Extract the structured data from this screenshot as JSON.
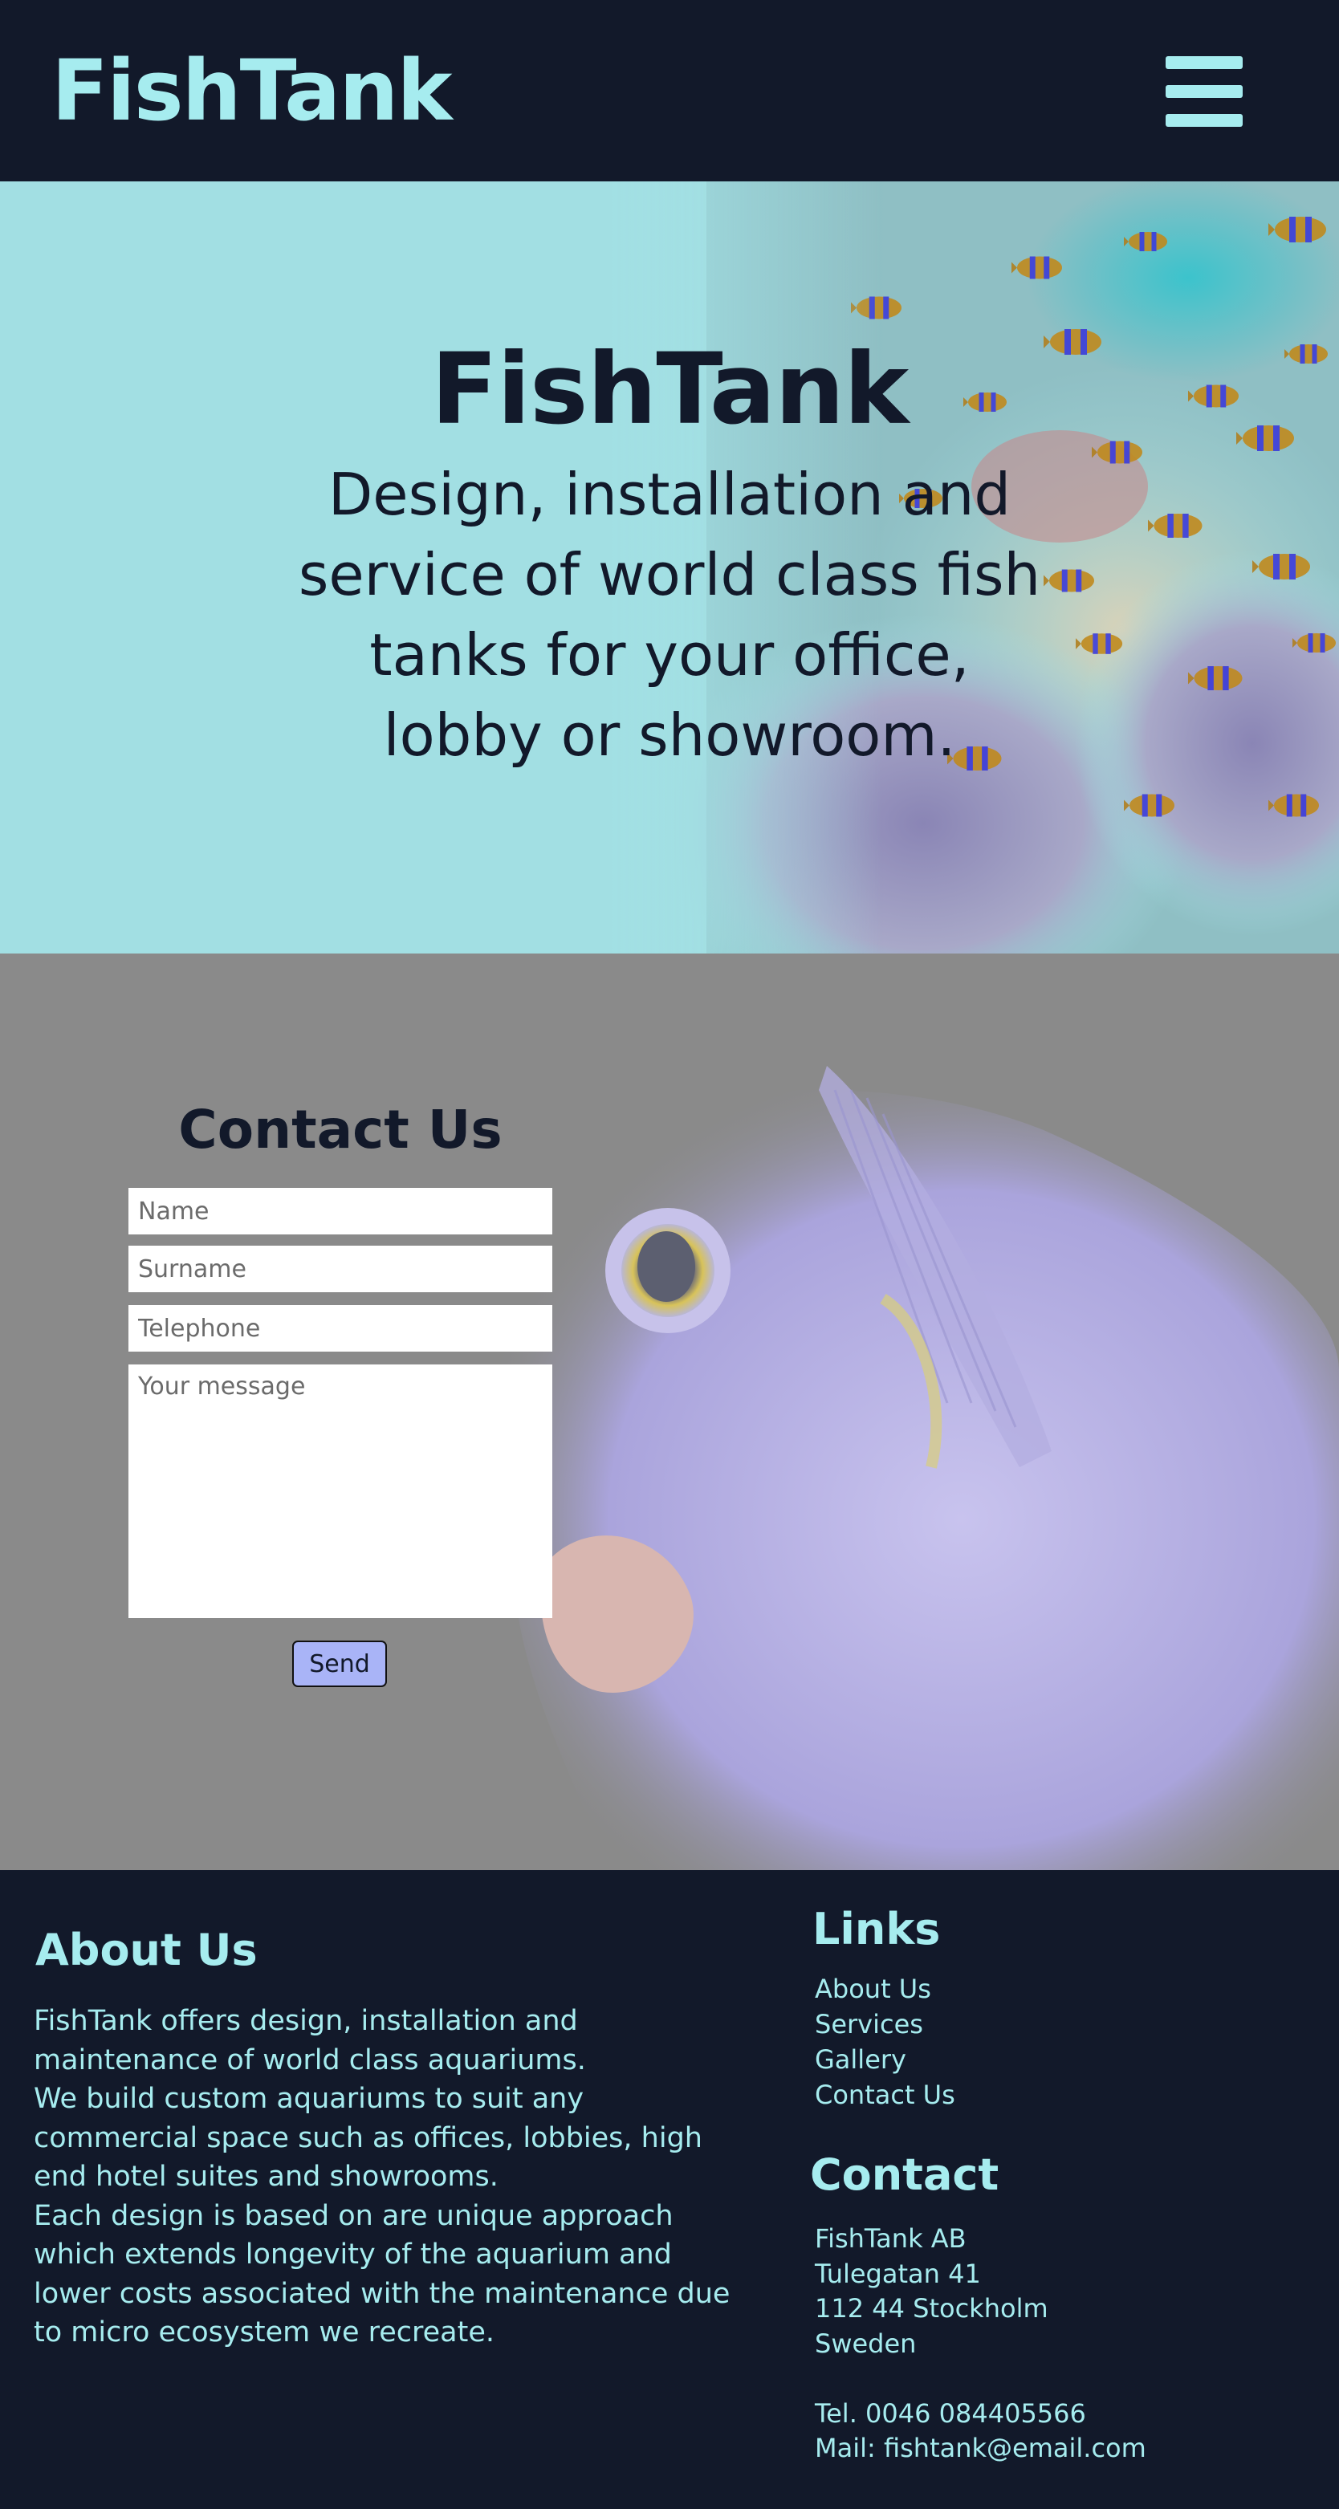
{
  "header": {
    "logo": "FishTank",
    "menu_icon": "hamburger-menu-icon"
  },
  "hero": {
    "title": "FishTank",
    "subtitle": "Design, installation and service of world class fish tanks for your office, lobby or showroom.",
    "background_color": "#a2dfe3",
    "image": "clownfish-anemone-photo"
  },
  "contact_form": {
    "title": "Contact Us",
    "name_placeholder": "Name",
    "surname_placeholder": "Surname",
    "telephone_placeholder": "Telephone",
    "message_placeholder": "Your message",
    "send_label": "Send",
    "image": "tropical-fish-closeup-photo"
  },
  "footer": {
    "about": {
      "title": "About Us",
      "paragraphs": [
        "FishTank offers design, installation and maintenance of world class aquariums.",
        "We build custom aquariums to suit any commercial space such as offices, lobbies, high end hotel suites and showrooms.",
        "Each design is based on are unique approach which extends longevity of the aquarium and lower costs associated with the maintenance due to micro ecosystem we recreate."
      ]
    },
    "links": {
      "title": "Links",
      "items": [
        "About Us",
        "Services",
        "Gallery",
        "Contact Us"
      ]
    },
    "contact": {
      "title": "Contact",
      "company": "FishTank AB",
      "street": "Tulegatan 41",
      "city": "112 44 Stockholm",
      "country": "Sweden",
      "phone": "Tel. 0046 084405566",
      "mail": "Mail: fishtank@email.com"
    }
  },
  "colors": {
    "navy": "#12192a",
    "aqua": "#a6ecef",
    "send_button": "#a9b4f7",
    "contact_bg": "#8a8a8a"
  }
}
